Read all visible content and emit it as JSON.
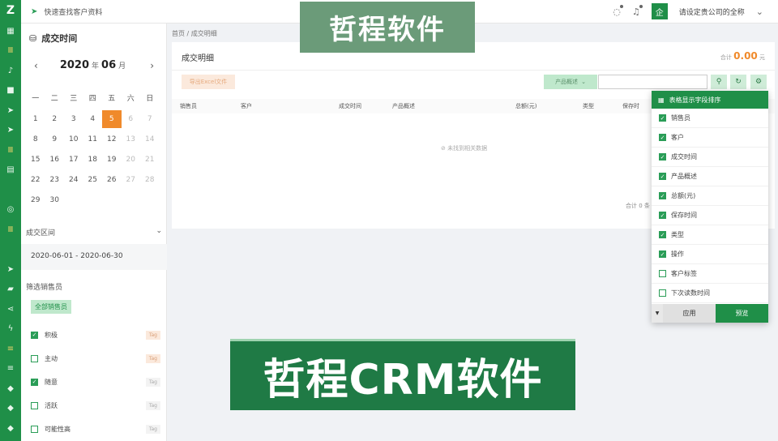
{
  "rail": {
    "logo": "Z",
    "icons": [
      "grid-icon",
      "bars-icon",
      "bell-icon",
      "video-icon",
      "send-icon",
      "send-icon",
      "bars-icon",
      "layout-icon",
      "target-icon",
      "bars-icon",
      "send-icon",
      "folder-icon",
      "share-icon",
      "bolt-icon",
      "list-icon",
      "list-icon",
      "tag-icon",
      "tag-icon",
      "tag-icon"
    ]
  },
  "topbar": {
    "search_link": "快速查找客户资料",
    "company": "请设定贵公司的全称",
    "avatar_text": "企"
  },
  "left": {
    "title": "成交时间",
    "year": "2020",
    "year_suffix": "年",
    "month": "06",
    "month_suffix": "月",
    "weekdays": [
      "一",
      "二",
      "三",
      "四",
      "五",
      "六",
      "日"
    ],
    "weeks": [
      [
        "1",
        "2",
        "3",
        "4",
        "5",
        "6",
        "7"
      ],
      [
        "8",
        "9",
        "10",
        "11",
        "12",
        "13",
        "14"
      ],
      [
        "15",
        "16",
        "17",
        "18",
        "19",
        "20",
        "21"
      ],
      [
        "22",
        "23",
        "24",
        "25",
        "26",
        "27",
        "28"
      ],
      [
        "29",
        "30",
        "",
        "",
        "",
        "",
        ""
      ]
    ],
    "selected_day": "5",
    "range_title": "成交区间",
    "range_value": "2020-06-01 - 2020-06-30",
    "filter_title": "筛选销售员",
    "all_sales": "全部销售员",
    "tags": [
      {
        "label": "积极",
        "checked": true,
        "pill": "Tag"
      },
      {
        "label": "主动",
        "checked": false,
        "pill": "Tag"
      },
      {
        "label": "随意",
        "checked": true,
        "pill": "Tag"
      },
      {
        "label": "活跃",
        "checked": false,
        "pill": "Tag"
      },
      {
        "label": "可能性高",
        "checked": false,
        "pill": "Tag"
      }
    ]
  },
  "main": {
    "breadcrumb": "首页 / 成交明细",
    "card_title": "成交明细",
    "total_label": "合计",
    "total_value": "0.00",
    "total_unit": "元",
    "export_button": "导出Excel文件",
    "product_button": "产品概述",
    "columns": [
      "销售员",
      "客户",
      "成交时间",
      "产品概述",
      "总额(元)",
      "类型",
      "保存时"
    ],
    "empty_text": "未找到相关数据",
    "footer_sum": "合计 0 条"
  },
  "popup": {
    "title": "表格显示字段排序",
    "fields": [
      {
        "label": "销售员",
        "checked": true
      },
      {
        "label": "客户",
        "checked": true
      },
      {
        "label": "成交时间",
        "checked": true
      },
      {
        "label": "产品概述",
        "checked": true
      },
      {
        "label": "总额(元)",
        "checked": true
      },
      {
        "label": "保存时间",
        "checked": true
      },
      {
        "label": "类型",
        "checked": true
      },
      {
        "label": "操作",
        "checked": true
      },
      {
        "label": "客户标签",
        "checked": false
      },
      {
        "label": "下次读数时间",
        "checked": false
      }
    ],
    "apply": "应用",
    "preview": "预览"
  },
  "banners": {
    "top": "哲程软件",
    "bottom": "哲程CRM软件"
  }
}
